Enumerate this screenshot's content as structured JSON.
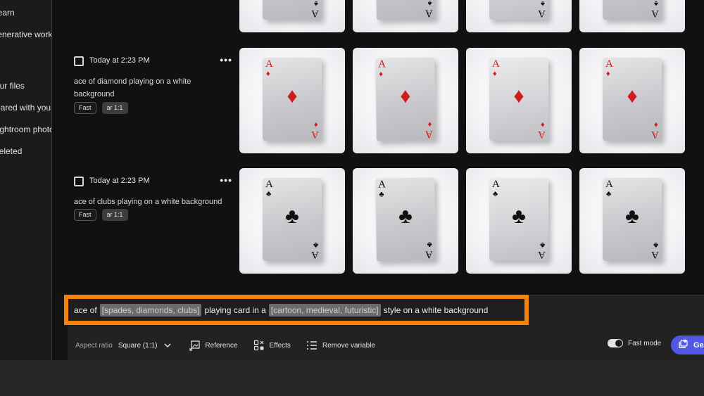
{
  "sidebar": {
    "items": [
      {
        "label": "Learn"
      },
      {
        "label": "Generative works"
      },
      {
        "label": "Your files"
      },
      {
        "label": "Shared with you"
      },
      {
        "label": "Lightroom photos"
      },
      {
        "label": "Deleted"
      }
    ]
  },
  "groups": [
    {
      "time": "Today at 2:23 PM",
      "prompt": "ace of diamond playing on a white background",
      "tags": [
        "Fast",
        "ar 1:1"
      ],
      "suit": "diamond",
      "suit_color": "#d01c1c",
      "rank": "A",
      "suit_glyph": "♦"
    },
    {
      "time": "Today at 2:23 PM",
      "prompt": "ace of clubs playing on a white background",
      "tags": [
        "Fast",
        "ar 1:1"
      ],
      "suit": "club",
      "suit_color": "#111111",
      "rank": "A",
      "suit_glyph": "♣"
    }
  ],
  "top_row": {
    "suit": "spade",
    "rank": "A",
    "suit_glyph": "♠"
  },
  "more_glyph": "•••",
  "prompt_bar": {
    "text_before": "ace of",
    "variable_1": "[spades, diamonds, clubs]",
    "text_middle": "playing card in a",
    "variable_2": "[cartoon, medieval, futuristic]",
    "text_after": "style on a white background",
    "highlight_color": "#f5820b"
  },
  "toolbar": {
    "aspect_label": "Aspect ratio",
    "aspect_value": "Square (1:1)",
    "reference_label": "Reference",
    "effects_label": "Effects",
    "remove_variable_label": "Remove variable",
    "fast_mode_label": "Fast mode",
    "fast_mode_on": true,
    "generate_label": "Ge",
    "generate_color": "#5258e4"
  }
}
